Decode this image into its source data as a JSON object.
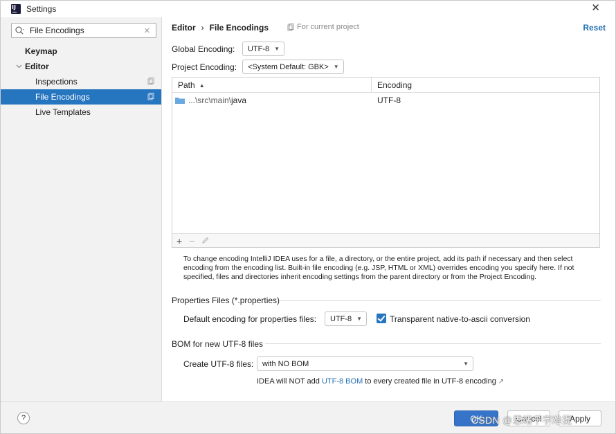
{
  "window": {
    "title": "Settings",
    "close_glyph": "✕"
  },
  "sidebar": {
    "search": {
      "value": "File Encodings",
      "clear_glyph": "✕"
    },
    "items": [
      {
        "label": "Keymap"
      },
      {
        "label": "Editor"
      },
      {
        "label": "Inspections"
      },
      {
        "label": "File Encodings"
      },
      {
        "label": "Live Templates"
      }
    ]
  },
  "main": {
    "breadcrumb": [
      "Editor",
      "File Encodings"
    ],
    "breadcrumb_sep": "›",
    "for_current_project": "For current project",
    "reset_label": "Reset",
    "global_encoding": {
      "label": "Global Encoding:",
      "value": "UTF-8"
    },
    "project_encoding": {
      "label": "Project Encoding:",
      "value": "<System Default: GBK>"
    },
    "table": {
      "columns": [
        "Path",
        "Encoding"
      ],
      "rows": [
        {
          "path_prefix": "...\\src\\main\\",
          "path_name": "java",
          "encoding": "UTF-8"
        }
      ],
      "toolbar": {
        "add": "+",
        "remove": "−"
      }
    },
    "help_text": "To change encoding IntelliJ IDEA uses for a file, a directory, or the entire project, add its path if necessary and then select encoding from the encoding list. Built-in file encoding (e.g. JSP, HTML or XML) overrides encoding you specify here. If not specified, files and directories inherit encoding settings from the parent directory or from the Project Encoding.",
    "properties_section": {
      "title": "Properties Files (*.properties)",
      "default_label": "Default encoding for properties files:",
      "default_value": "UTF-8",
      "checkbox_label": "Transparent native-to-ascii conversion",
      "checkbox_checked": true
    },
    "bom_section": {
      "title": "BOM for new UTF-8 files",
      "create_label": "Create UTF-8 files:",
      "create_value": "with NO BOM",
      "note_before": "IDEA will NOT add ",
      "note_link": "UTF-8 BOM",
      "note_after": " to every created file in UTF-8 encoding ",
      "note_ext": "↗"
    }
  },
  "footer": {
    "help_glyph": "?",
    "ok_label": "OK",
    "cancel_label": "Cancel",
    "apply_label": "Apply"
  },
  "watermark": "CSDN @思绪千字难提",
  "colors": {
    "accent": "#2675bf",
    "link": "#2470b3",
    "sidebar_bg": "#f2f2f2"
  },
  "icons": [
    "app-logo-icon",
    "close-icon",
    "search-icon",
    "chevron-down-icon",
    "project-scope-icon",
    "folder-icon",
    "sort-ascending-icon",
    "edit-pencil-icon",
    "external-link-icon",
    "help-icon"
  ]
}
